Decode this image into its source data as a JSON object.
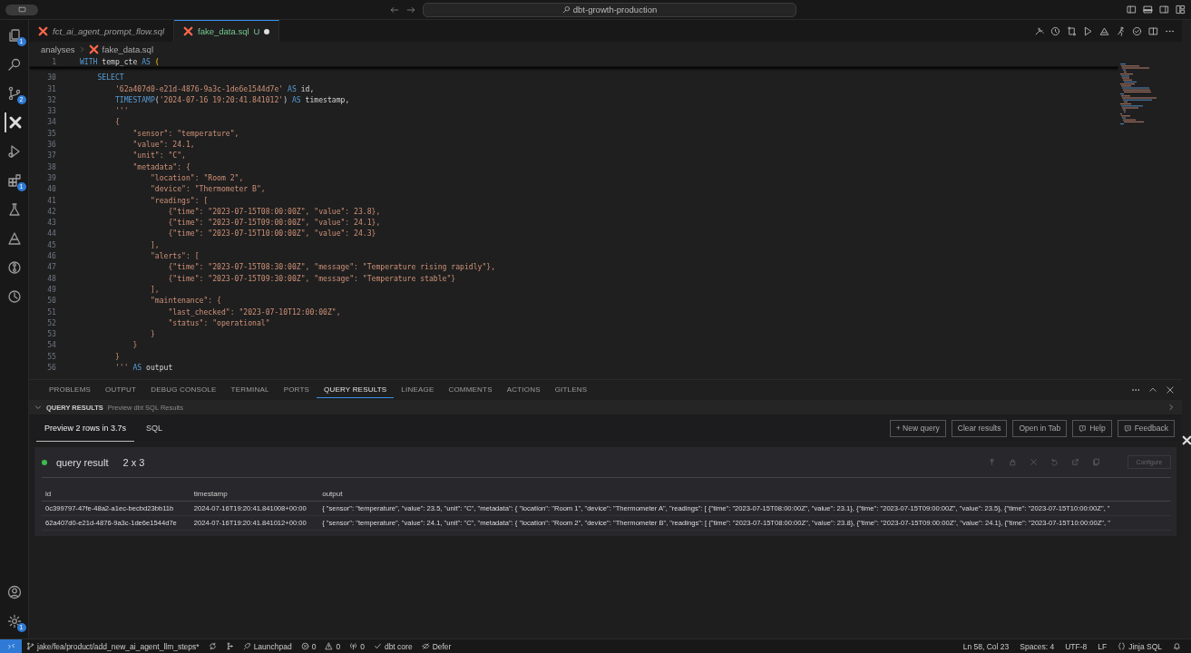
{
  "title_bar": {
    "search": "dbt-growth-production"
  },
  "activity_bar": {
    "items": [
      {
        "kind": "files",
        "badge": "1"
      },
      {
        "kind": "search"
      },
      {
        "kind": "source",
        "badge": "2"
      },
      {
        "kind": "dbt",
        "selected": true
      },
      {
        "kind": "run"
      },
      {
        "kind": "extensions",
        "badge": "1"
      },
      {
        "kind": "flask"
      },
      {
        "kind": "triangle"
      },
      {
        "kind": "gitlens"
      },
      {
        "kind": "history"
      }
    ],
    "bottom": [
      {
        "kind": "account"
      },
      {
        "kind": "settings",
        "badge": "1"
      }
    ]
  },
  "editor_tabs": [
    {
      "label": "fct_ai_agent_prompt_flow.sql",
      "selected": false,
      "preview": true
    },
    {
      "label": "fake_data.sql",
      "selected": true,
      "preview": false,
      "status": "U",
      "modified": true
    }
  ],
  "breadcrumb": [
    "analyses",
    "fake_data.sql"
  ],
  "sticky_line": {
    "number": "1",
    "tokens": [
      {
        "kind": "keyword",
        "text": "WITH"
      },
      {
        "kind": "plain",
        "text": " temp_cte "
      },
      {
        "kind": "keyword",
        "text": "AS"
      },
      {
        "kind": "paren",
        "text": " ("
      }
    ]
  },
  "code_lines": [
    {
      "number": "30",
      "tokens": [
        {
          "kind": "keyword",
          "text": "    SELECT"
        }
      ]
    },
    {
      "number": "31",
      "tokens": [
        {
          "kind": "string",
          "text": "        '62a407d0-e21d-4876-9a3c-1de6e1544d7e'"
        },
        {
          "kind": "keyword",
          "text": " AS"
        },
        {
          "kind": "plain",
          "text": " id,"
        }
      ]
    },
    {
      "number": "32",
      "tokens": [
        {
          "kind": "keyword",
          "text": "        TIMESTAMP"
        },
        {
          "kind": "plain",
          "text": "("
        },
        {
          "kind": "string",
          "text": "'2024-07-16 19:20:41.841012'"
        },
        {
          "kind": "plain",
          "text": ")"
        },
        {
          "kind": "keyword",
          "text": " AS"
        },
        {
          "kind": "plain",
          "text": " timestamp,"
        }
      ]
    },
    {
      "number": "33",
      "tokens": [
        {
          "kind": "string",
          "text": "        '''"
        }
      ]
    },
    {
      "number": "34",
      "tokens": [
        {
          "kind": "string",
          "text": "        {"
        }
      ]
    },
    {
      "number": "35",
      "tokens": [
        {
          "kind": "string",
          "text": "            \"sensor\": \"temperature\","
        }
      ]
    },
    {
      "number": "36",
      "tokens": [
        {
          "kind": "string",
          "text": "            \"value\": 24.1,"
        }
      ]
    },
    {
      "number": "37",
      "tokens": [
        {
          "kind": "string",
          "text": "            \"unit\": \"C\","
        }
      ]
    },
    {
      "number": "38",
      "tokens": [
        {
          "kind": "string",
          "text": "            \"metadata\": {"
        }
      ]
    },
    {
      "number": "39",
      "tokens": [
        {
          "kind": "string",
          "text": "                \"location\": \"Room 2\","
        }
      ]
    },
    {
      "number": "40",
      "tokens": [
        {
          "kind": "string",
          "text": "                \"device\": \"Thermometer B\","
        }
      ]
    },
    {
      "number": "41",
      "tokens": [
        {
          "kind": "string",
          "text": "                \"readings\": ["
        }
      ]
    },
    {
      "number": "42",
      "tokens": [
        {
          "kind": "string",
          "text": "                    {\"time\": \"2023-07-15T08:00:00Z\", \"value\": 23.8},"
        }
      ]
    },
    {
      "number": "43",
      "tokens": [
        {
          "kind": "string",
          "text": "                    {\"time\": \"2023-07-15T09:00:00Z\", \"value\": 24.1},"
        }
      ]
    },
    {
      "number": "44",
      "tokens": [
        {
          "kind": "string",
          "text": "                    {\"time\": \"2023-07-15T10:00:00Z\", \"value\": 24.3}"
        }
      ]
    },
    {
      "number": "45",
      "tokens": [
        {
          "kind": "string",
          "text": "                ],"
        }
      ]
    },
    {
      "number": "46",
      "tokens": [
        {
          "kind": "string",
          "text": "                \"alerts\": ["
        }
      ]
    },
    {
      "number": "47",
      "tokens": [
        {
          "kind": "string",
          "text": "                    {\"time\": \"2023-07-15T08:30:00Z\", \"message\": \"Temperature rising rapidly\"},"
        }
      ]
    },
    {
      "number": "48",
      "tokens": [
        {
          "kind": "string",
          "text": "                    {\"time\": \"2023-07-15T09:30:00Z\", \"message\": \"Temperature stable\"}"
        }
      ]
    },
    {
      "number": "49",
      "tokens": [
        {
          "kind": "string",
          "text": "                ],"
        }
      ]
    },
    {
      "number": "50",
      "tokens": [
        {
          "kind": "string",
          "text": "                \"maintenance\": {"
        }
      ]
    },
    {
      "number": "51",
      "tokens": [
        {
          "kind": "string",
          "text": "                    \"last_checked\": \"2023-07-10T12:00:00Z\","
        }
      ]
    },
    {
      "number": "52",
      "tokens": [
        {
          "kind": "string",
          "text": "                    \"status\": \"operational\""
        }
      ]
    },
    {
      "number": "53",
      "tokens": [
        {
          "kind": "string",
          "text": "                }"
        }
      ]
    },
    {
      "number": "54",
      "tokens": [
        {
          "kind": "string",
          "text": "            }"
        }
      ]
    },
    {
      "number": "55",
      "tokens": [
        {
          "kind": "string",
          "text": "        }"
        }
      ]
    },
    {
      "number": "56",
      "tokens": [
        {
          "kind": "string",
          "text": "        '''"
        },
        {
          "kind": "keyword",
          "text": " AS"
        },
        {
          "kind": "plain",
          "text": " output"
        }
      ]
    }
  ],
  "panel_tabs": [
    {
      "label": "PROBLEMS",
      "selected": false
    },
    {
      "label": "OUTPUT",
      "selected": false
    },
    {
      "label": "DEBUG CONSOLE",
      "selected": false
    },
    {
      "label": "TERMINAL",
      "selected": false
    },
    {
      "label": "PORTS",
      "selected": false
    },
    {
      "label": "QUERY RESULTS",
      "selected": true
    },
    {
      "label": "LINEAGE",
      "selected": false
    },
    {
      "label": "COMMENTS",
      "selected": false
    },
    {
      "label": "ACTIONS",
      "selected": false
    },
    {
      "label": "GITLENS",
      "selected": false
    }
  ],
  "panel_header": {
    "title": "QUERY RESULTS",
    "subtitle": "Preview dbt SQL Results"
  },
  "result_tabs": [
    {
      "label": "Preview 2 rows in 3.7s",
      "selected": true
    },
    {
      "label": "SQL",
      "selected": false
    }
  ],
  "result_buttons": [
    {
      "label": "+ New query"
    },
    {
      "label": "Clear results"
    },
    {
      "label": "Open in Tab"
    },
    {
      "label": "Help",
      "kind": "help"
    },
    {
      "label": "Feedback",
      "kind": "feedback"
    }
  ],
  "result_card": {
    "title": "query result",
    "shape": "2 x 3",
    "configure": {
      "label": "Configure",
      "disabled": true
    },
    "columns": [
      "id",
      "timestamp",
      "output"
    ],
    "rows": [
      [
        "0c399797-47fe-48a2-a1ec-becbd23bb11b",
        "2024-07-16T19:20:41.841008+00:00",
        "{ \"sensor\": \"temperature\", \"value\": 23.5, \"unit\": \"C\", \"metadata\": { \"location\": \"Room 1\", \"device\": \"Thermometer A\", \"readings\": [ {\"time\": \"2023-07-15T08:00:00Z\", \"value\": 23.1}, {\"time\": \"2023-07-15T09:00:00Z\", \"value\": 23.5}, {\"time\": \"2023-07-15T10:00:00Z\", \""
      ],
      [
        "62a407d0-e21d-4876-9a3c-1de6e1544d7e",
        "2024-07-16T19:20:41.841012+00:00",
        "{ \"sensor\": \"temperature\", \"value\": 24.1, \"unit\": \"C\", \"metadata\": { \"location\": \"Room 2\", \"device\": \"Thermometer B\", \"readings\": [ {\"time\": \"2023-07-15T08:00:00Z\", \"value\": 23.8}, {\"time\": \"2023-07-15T09:00:00Z\", \"value\": 24.1}, {\"time\": \"2023-07-15T10:00:00Z\", \""
      ]
    ]
  },
  "status_bar": {
    "left": [
      {
        "kind": "branch",
        "text": "jake/fea/product/add_new_ai_agent_llm_steps*"
      },
      {
        "kind": "sync"
      },
      {
        "kind": "graph"
      },
      {
        "kind": "launchpad",
        "text": "Launchpad"
      },
      {
        "kind": "errors",
        "text": "0"
      },
      {
        "kind": "warnings",
        "text": "0"
      },
      {
        "kind": "ports",
        "text": "0"
      },
      {
        "kind": "check",
        "text": "dbt core"
      },
      {
        "kind": "defer",
        "text": "Defer"
      }
    ],
    "right": [
      {
        "kind": "text",
        "text": "Ln 58, Col 23"
      },
      {
        "kind": "text",
        "text": "Spaces: 4"
      },
      {
        "kind": "text",
        "text": "UTF-8"
      },
      {
        "kind": "text",
        "text": "LF"
      },
      {
        "kind": "language",
        "text": "Jinja SQL"
      },
      {
        "kind": "bell"
      }
    ]
  }
}
